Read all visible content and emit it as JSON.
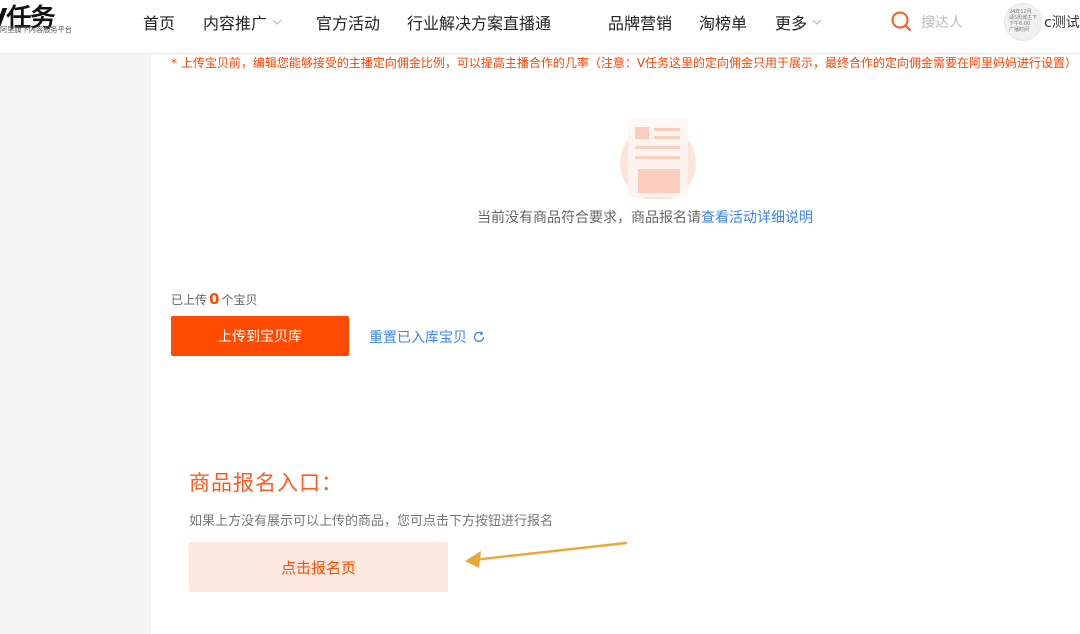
{
  "header": {
    "logo_title": "V任务",
    "logo_subtitle": "阿里旗下内容服务平台",
    "nav": [
      {
        "label": "首页",
        "dropdown": false
      },
      {
        "label": "内容推广",
        "dropdown": true
      },
      {
        "label": "官方活动",
        "dropdown": false
      },
      {
        "label": "行业解决方案",
        "dropdown": false
      },
      {
        "label": "直播通",
        "dropdown": false
      },
      {
        "label": "品牌营销",
        "dropdown": false
      },
      {
        "label": "淘榜单",
        "dropdown": false
      },
      {
        "label": "更多",
        "dropdown": true
      }
    ],
    "search_placeholder": "搜达人",
    "avatar_lines": [
      "24年12月",
      "请5周城主下",
      "下午6:00",
      "广播时间"
    ],
    "user_name": "c测试"
  },
  "main": {
    "notice": "* 上传宝贝前，编辑您能够接受的主播定向佣金比例，可以提高主播合作的几率（注意：V任务这里的定向佣金只用于展示，最终合作的定向佣金需要在阿里妈妈进行设置）",
    "empty_text": "当前没有商品符合要求，商品报名请",
    "empty_link": "查看活动详细说明",
    "uploaded_prefix": "已上传",
    "uploaded_count": "0",
    "uploaded_suffix": "个宝贝",
    "upload_button": "上传到宝贝库",
    "reset_link": "重置已入库宝贝",
    "entry_title": "商品报名入口：",
    "entry_desc": "如果上方没有展示可以上传的商品，您可点击下方按钮进行报名",
    "entry_button": "点击报名页"
  },
  "colors": {
    "accent": "#ff4a00",
    "link": "#3b86e8",
    "arrow": "#e8a93a"
  },
  "icons": [
    "search-icon",
    "chevron-down-icon",
    "refresh-icon",
    "empty-document-icon",
    "arrow-pointer"
  ]
}
